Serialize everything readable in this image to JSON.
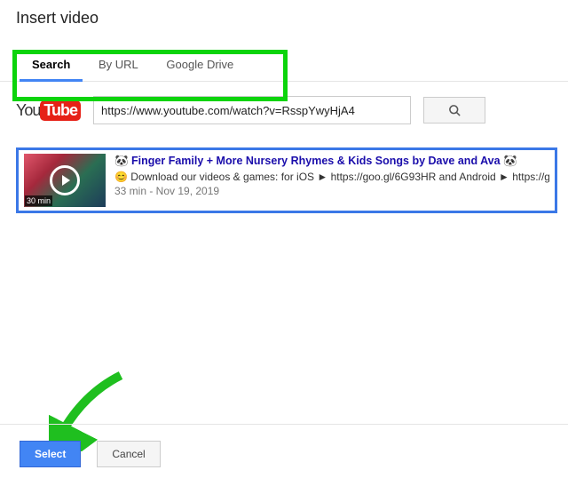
{
  "dialog": {
    "title": "Insert video"
  },
  "tabs": {
    "items": [
      {
        "label": "Search",
        "active": true
      },
      {
        "label": "By URL",
        "active": false
      },
      {
        "label": "Google Drive",
        "active": false
      }
    ]
  },
  "search": {
    "provider": "YouTube",
    "input_value": "https://www.youtube.com/watch?v=RsspYwyHjA4",
    "button_icon": "search-icon"
  },
  "result": {
    "thumbnail_duration": "30 min",
    "title": "🐼 Finger Family + More Nursery Rhymes & Kids Songs by Dave and Ava 🐼",
    "description": "😊 Download our videos & games: for iOS ► https://goo.gl/6G93HR and Android ► https://goo.gl/... songs for kids by Dave and Ava! Subscribe now for new nursery rhymes - https://www.youtube.",
    "meta": "33 min - Nov 19, 2019"
  },
  "footer": {
    "primary_label": "Select",
    "cancel_label": "Cancel"
  },
  "annotations": {
    "tabs_highlight_color": "#0bd40b",
    "arrow_color": "#1fbf1f"
  }
}
